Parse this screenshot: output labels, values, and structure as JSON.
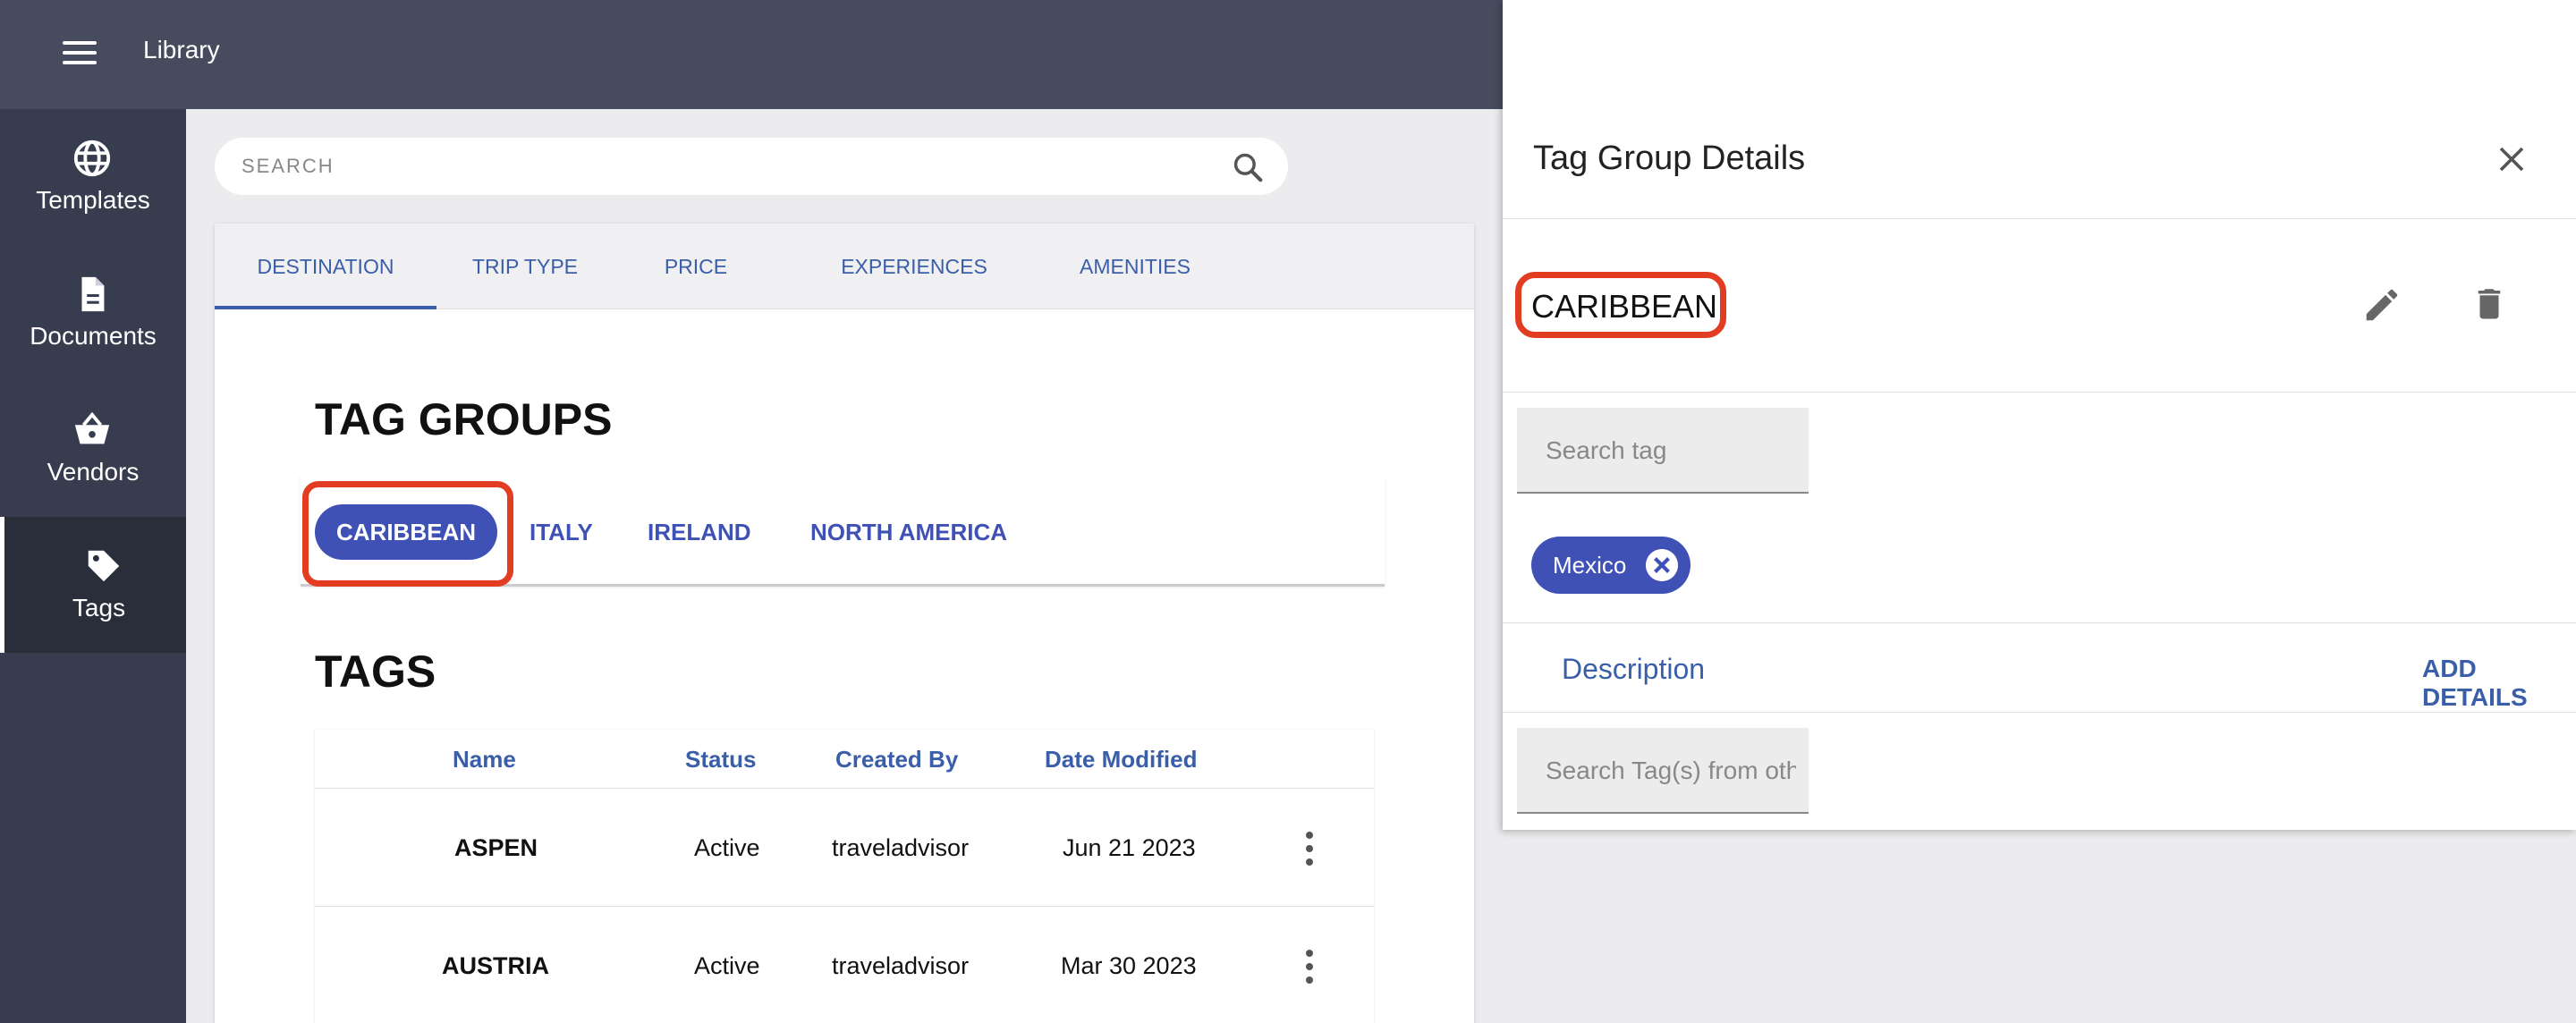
{
  "app": {
    "title": "Library"
  },
  "sidebar": {
    "items": [
      {
        "label": "Templates",
        "icon": "globe-icon"
      },
      {
        "label": "Documents",
        "icon": "document-icon"
      },
      {
        "label": "Vendors",
        "icon": "basket-icon"
      },
      {
        "label": "Tags",
        "icon": "tag-icon",
        "active": true
      }
    ]
  },
  "search": {
    "placeholder": "SEARCH"
  },
  "tabs": [
    "DESTINATION",
    "TRIP TYPE",
    "PRICE",
    "EXPERIENCES",
    "AMENITIES"
  ],
  "tag_groups": {
    "title": "TAG GROUPS",
    "items": [
      "CARIBBEAN",
      "ITALY",
      "IRELAND",
      "NORTH AMERICA"
    ],
    "selected": "CARIBBEAN"
  },
  "tags": {
    "title": "TAGS",
    "columns": [
      "Name",
      "Status",
      "Created By",
      "Date Modified"
    ],
    "rows": [
      {
        "name": "ASPEN",
        "status": "Active",
        "created_by": "traveladvisor",
        "date_modified": "Jun 21 2023"
      },
      {
        "name": "AUSTRIA",
        "status": "Active",
        "created_by": "traveladvisor",
        "date_modified": "Mar 30 2023"
      }
    ]
  },
  "drawer": {
    "title": "Tag Group Details",
    "group_name": "CARIBBEAN",
    "tag_search_placeholder": "Search tag",
    "tags": [
      "Mexico"
    ],
    "description_label": "Description",
    "add_details_label": "ADD DETAILS",
    "other_search_placeholder": "Search Tag(s) from other groups"
  },
  "colors": {
    "topbar": "#464c5e",
    "sidebar": "#373d4e",
    "accent": "#3f51b5",
    "link": "#3a5ea8",
    "highlight": "#e23c23"
  }
}
